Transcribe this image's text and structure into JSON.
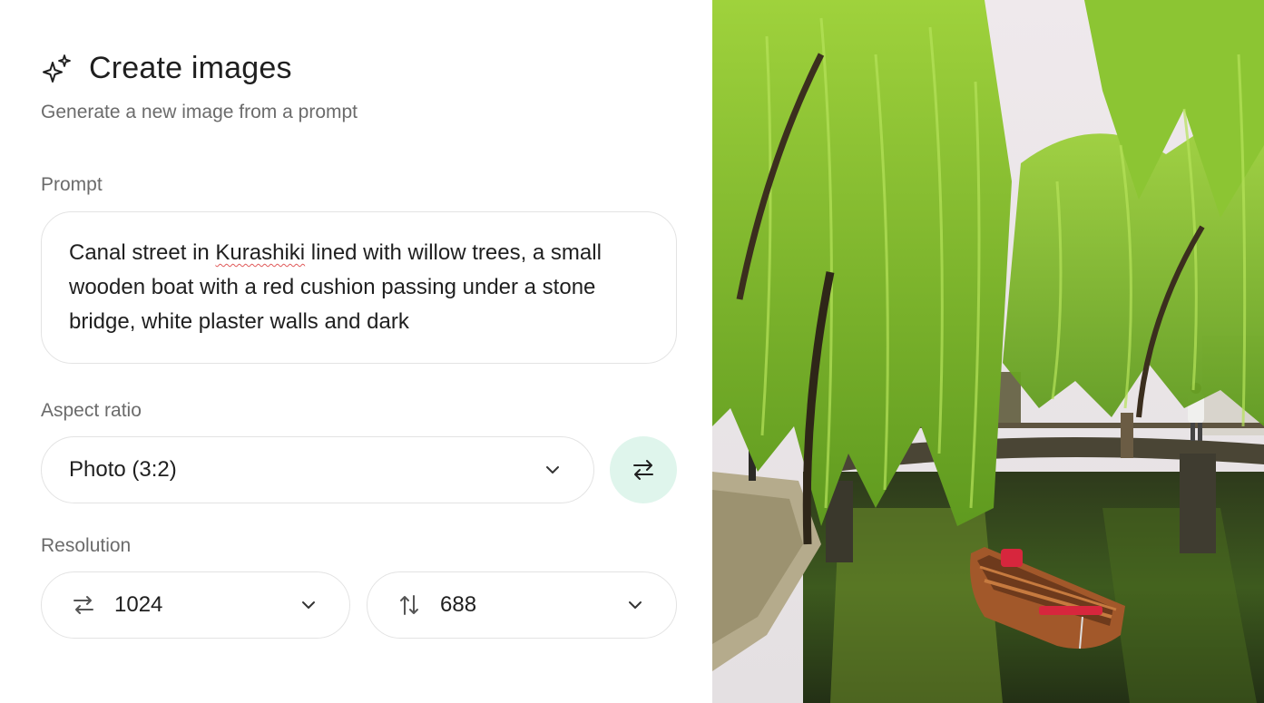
{
  "header": {
    "title": "Create images",
    "subtitle": "Generate a new image from a prompt",
    "icon": "sparkles-icon"
  },
  "prompt": {
    "label": "Prompt",
    "text_before": "Canal street in ",
    "text_misspelled": "Kurashiki",
    "text_after": " lined with willow trees, a small wooden boat with a red cushion passing under a stone bridge, white plaster walls and dark"
  },
  "aspect_ratio": {
    "label": "Aspect ratio",
    "selected": "Photo (3:2)",
    "swap_icon": "swap-horizontal-icon"
  },
  "resolution": {
    "label": "Resolution",
    "width": "1024",
    "height": "688",
    "width_icon": "arrows-left-right-icon",
    "height_icon": "arrows-up-down-icon"
  },
  "colors": {
    "swap_button_bg": "#dff5ec",
    "border": "#e3e3e3",
    "muted_text": "#6b6b6b"
  }
}
